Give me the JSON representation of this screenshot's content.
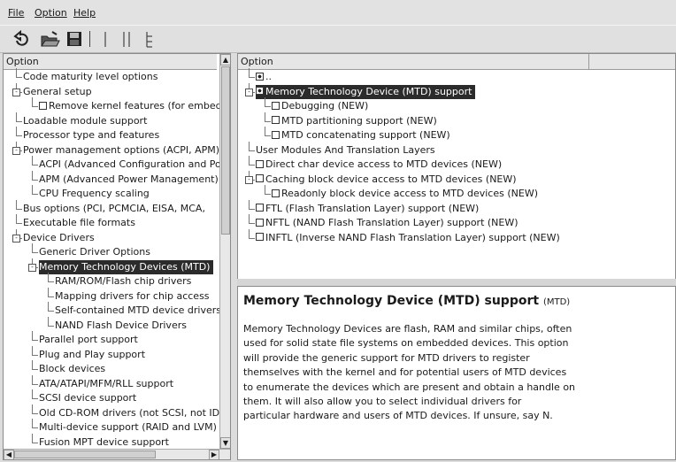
{
  "menubar": {
    "file": "File",
    "option": "Option",
    "help": "Help"
  },
  "toolbar": {
    "icons": [
      "undo-icon",
      "open-folder-icon",
      "save-icon",
      "single-view-icon",
      "split-view-icon",
      "full-tree-view-icon"
    ]
  },
  "left_pane": {
    "header": "Option",
    "items": [
      {
        "label": "Code maturity level options",
        "depth": 0
      },
      {
        "label": "General setup",
        "depth": 0,
        "expander": "-"
      },
      {
        "label": "Remove kernel features (for embedd",
        "depth": 1,
        "checkbox": true
      },
      {
        "label": "Loadable module support",
        "depth": 0
      },
      {
        "label": "Processor type and features",
        "depth": 0
      },
      {
        "label": "Power management options (ACPI, APM)",
        "depth": 0,
        "expander": "-"
      },
      {
        "label": "ACPI (Advanced Configuration and Po",
        "depth": 1
      },
      {
        "label": "APM (Advanced Power Management)",
        "depth": 1
      },
      {
        "label": "CPU Frequency scaling",
        "depth": 1
      },
      {
        "label": "Bus options (PCI, PCMCIA, EISA, MCA,",
        "depth": 0
      },
      {
        "label": "Executable file formats",
        "depth": 0
      },
      {
        "label": "Device Drivers",
        "depth": 0,
        "expander": "-"
      },
      {
        "label": "Generic Driver Options",
        "depth": 1
      },
      {
        "label": "Memory Technology Devices (MTD)",
        "depth": 1,
        "expander": "-",
        "selected": true
      },
      {
        "label": "RAM/ROM/Flash chip drivers",
        "depth": 2
      },
      {
        "label": "Mapping drivers for chip access",
        "depth": 2
      },
      {
        "label": "Self-contained MTD device drivers",
        "depth": 2
      },
      {
        "label": "NAND Flash Device Drivers",
        "depth": 2
      },
      {
        "label": "Parallel port support",
        "depth": 1
      },
      {
        "label": "Plug and Play support",
        "depth": 1
      },
      {
        "label": "Block devices",
        "depth": 1
      },
      {
        "label": "ATA/ATAPI/MFM/RLL support",
        "depth": 1
      },
      {
        "label": "SCSI device support",
        "depth": 1
      },
      {
        "label": "Old CD-ROM drivers (not SCSI, not ID",
        "depth": 1
      },
      {
        "label": "Multi-device support (RAID and LVM)",
        "depth": 1
      },
      {
        "label": "Fusion MPT device support",
        "depth": 1
      }
    ]
  },
  "right_pane": {
    "header_option": "Option",
    "header_value": "",
    "items": [
      {
        "label": "..",
        "depth": 0,
        "checkbox": "mixed"
      },
      {
        "label": "Memory Technology Device (MTD) support",
        "depth": 0,
        "checkbox": "mixed",
        "selected": true,
        "expander": "-"
      },
      {
        "label": "Debugging (NEW)",
        "depth": 1,
        "checkbox": true
      },
      {
        "label": "MTD partitioning support (NEW)",
        "depth": 1,
        "checkbox": true
      },
      {
        "label": "MTD concatenating support (NEW)",
        "depth": 1,
        "checkbox": true
      },
      {
        "label": "User Modules And Translation Layers",
        "depth": 0
      },
      {
        "label": "Direct char device access to MTD devices (NEW)",
        "depth": 0,
        "checkbox": true
      },
      {
        "label": "Caching block device access to MTD devices (NEW)",
        "depth": 0,
        "checkbox": true,
        "expander": "-"
      },
      {
        "label": "Readonly block device access to MTD devices (NEW)",
        "depth": 1,
        "checkbox": true
      },
      {
        "label": "FTL (Flash Translation Layer) support (NEW)",
        "depth": 0,
        "checkbox": true
      },
      {
        "label": "NFTL (NAND Flash Translation Layer) support (NEW)",
        "depth": 0,
        "checkbox": true
      },
      {
        "label": "INFTL (Inverse NAND Flash Translation Layer) support (NEW)",
        "depth": 0,
        "checkbox": true
      }
    ]
  },
  "help": {
    "title": "Memory Technology Device (MTD) support",
    "symbol": "(MTD)",
    "lines": [
      "Memory Technology Devices are flash, RAM and similar chips, often",
      "used for solid state file systems on embedded devices. This option",
      "will provide the generic support for MTD drivers to register",
      "themselves with the kernel and for potential users of MTD devices",
      "to enumerate the devices which are present and obtain a handle on",
      "them. It will also allow you to select individual drivers for",
      "particular hardware and users of MTD devices. If unsure, say N."
    ]
  }
}
